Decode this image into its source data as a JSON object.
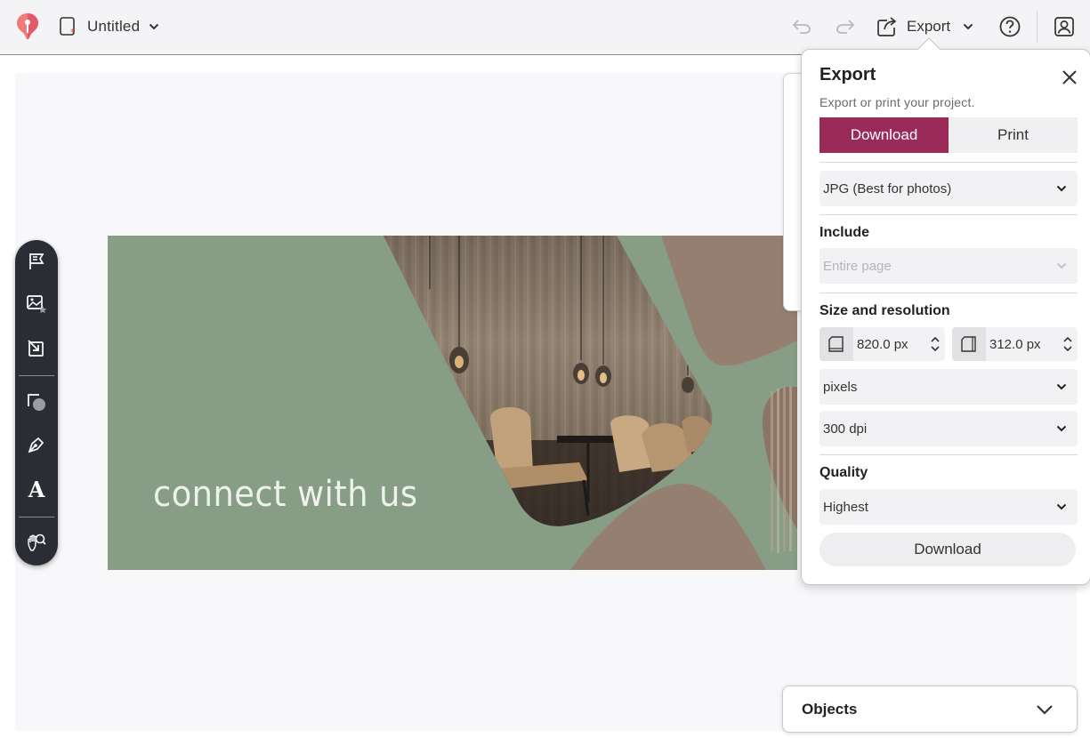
{
  "header": {
    "doc_title": "Untitled",
    "export_label": "Export"
  },
  "canvas": {
    "banner_text": "connect with us"
  },
  "export_popup": {
    "title": "Export",
    "subtitle": "Export or print your project.",
    "tabs": [
      {
        "label": "Download",
        "active": true
      },
      {
        "label": "Print",
        "active": false
      }
    ],
    "format_value": "JPG (Best for photos)",
    "include_label": "Include",
    "include_value": "Entire page",
    "size_label": "Size and resolution",
    "width_value": "820.0 px",
    "height_value": "312.0 px",
    "units_value": "pixels",
    "dpi_value": "300 dpi",
    "quality_label": "Quality",
    "quality_value": "Highest",
    "download_button": "Download"
  },
  "objects_panel": {
    "label": "Objects"
  },
  "colors": {
    "accent": "#9a2a57",
    "toolbar_bg": "#2b2d35",
    "banner_green": "#879d86",
    "banner_brown": "#957f70"
  },
  "icons": [
    "logo-icon",
    "document-icon",
    "chevron-down-icon",
    "undo-icon",
    "redo-icon",
    "export-icon",
    "help-icon",
    "account-icon",
    "close-icon",
    "flag-icon",
    "image-icon",
    "crop-icon",
    "shapes-icon",
    "pen-icon",
    "text-icon",
    "hand-icon"
  ]
}
